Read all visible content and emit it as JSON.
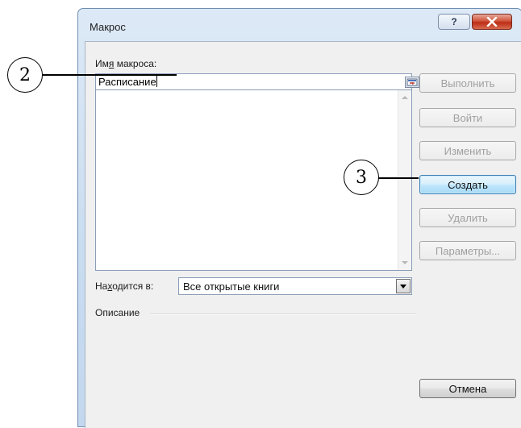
{
  "dialog": {
    "title": "Макрос",
    "help_button": "?",
    "name_label_pre": "Им",
    "name_label_u": "я",
    "name_label_post": " макроса:",
    "name_value": "Расписание",
    "macros_in_label_pre": "На",
    "macros_in_label_u": "х",
    "macros_in_label_post": "одится в:",
    "macros_in_value": "Все открытые книги",
    "description_label": "Описание",
    "buttons": {
      "run": "Выполнить",
      "step_into": "Войти",
      "edit": "Изменить",
      "create_pre": "Соз",
      "create_u": "д",
      "create_post": "ать",
      "delete": "Удалить",
      "options": "Параметры...",
      "cancel": "Отмена"
    }
  },
  "callouts": {
    "c2": "2",
    "c3": "3"
  },
  "colors": {
    "close_button": "#c8432b",
    "active_button_border": "#3c7fb1",
    "frame": "#c9dcf0"
  }
}
